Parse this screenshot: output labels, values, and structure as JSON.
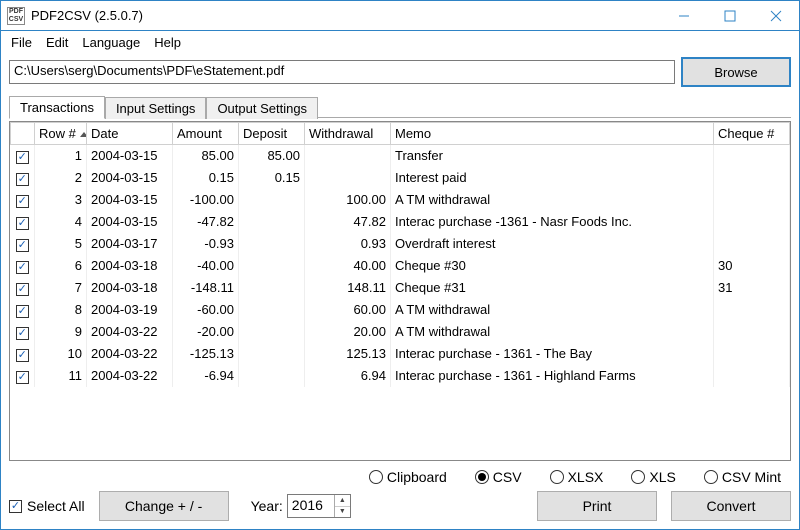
{
  "window": {
    "title": "PDF2CSV (2.5.0.7)",
    "icon_lines": [
      "PDF",
      "↓",
      "CSV"
    ]
  },
  "menu": [
    "File",
    "Edit",
    "Language",
    "Help"
  ],
  "file_path": "C:\\Users\\serg\\Documents\\PDF\\eStatement.pdf",
  "browse_label": "Browse",
  "tabs": [
    {
      "label": "Transactions",
      "active": true
    },
    {
      "label": "Input Settings",
      "active": false
    },
    {
      "label": "Output Settings",
      "active": false
    }
  ],
  "columns": {
    "row": "Row #",
    "date": "Date",
    "amount": "Amount",
    "deposit": "Deposit",
    "withdrawal": "Withdrawal",
    "memo": "Memo",
    "cheque": "Cheque #"
  },
  "rows": [
    {
      "n": "1",
      "date": "2004-03-15",
      "amount": "85.00",
      "deposit": "85.00",
      "withdrawal": "",
      "memo": "Transfer",
      "cheque": ""
    },
    {
      "n": "2",
      "date": "2004-03-15",
      "amount": "0.15",
      "deposit": "0.15",
      "withdrawal": "",
      "memo": "Interest paid",
      "cheque": ""
    },
    {
      "n": "3",
      "date": "2004-03-15",
      "amount": "-100.00",
      "deposit": "",
      "withdrawal": "100.00",
      "memo": "A TM withdrawal",
      "cheque": ""
    },
    {
      "n": "4",
      "date": "2004-03-15",
      "amount": "-47.82",
      "deposit": "",
      "withdrawal": "47.82",
      "memo": "Interac purchase -1361 - Nasr Foods Inc.",
      "cheque": ""
    },
    {
      "n": "5",
      "date": "2004-03-17",
      "amount": "-0.93",
      "deposit": "",
      "withdrawal": "0.93",
      "memo": "Overdraft interest",
      "cheque": ""
    },
    {
      "n": "6",
      "date": "2004-03-18",
      "amount": "-40.00",
      "deposit": "",
      "withdrawal": "40.00",
      "memo": "Cheque #30",
      "cheque": "30"
    },
    {
      "n": "7",
      "date": "2004-03-18",
      "amount": "-148.11",
      "deposit": "",
      "withdrawal": "148.11",
      "memo": "Cheque #31",
      "cheque": "31"
    },
    {
      "n": "8",
      "date": "2004-03-19",
      "amount": "-60.00",
      "deposit": "",
      "withdrawal": "60.00",
      "memo": "A TM withdrawal",
      "cheque": ""
    },
    {
      "n": "9",
      "date": "2004-03-22",
      "amount": "-20.00",
      "deposit": "",
      "withdrawal": "20.00",
      "memo": "A TM withdrawal",
      "cheque": ""
    },
    {
      "n": "10",
      "date": "2004-03-22",
      "amount": "-125.13",
      "deposit": "",
      "withdrawal": "125.13",
      "memo": "Interac purchase - 1361 - The Bay",
      "cheque": ""
    },
    {
      "n": "11",
      "date": "2004-03-22",
      "amount": "-6.94",
      "deposit": "",
      "withdrawal": "6.94",
      "memo": "Interac purchase - 1361 - Highland Farms",
      "cheque": ""
    }
  ],
  "export_options": [
    {
      "label": "Clipboard",
      "selected": false
    },
    {
      "label": "CSV",
      "selected": true
    },
    {
      "label": "XLSX",
      "selected": false
    },
    {
      "label": "XLS",
      "selected": false
    },
    {
      "label": "CSV Mint",
      "selected": false
    }
  ],
  "select_all_label": "Select All",
  "change_sign_label": "Change + / -",
  "year_label": "Year:",
  "year_value": "2016",
  "print_label": "Print",
  "convert_label": "Convert"
}
